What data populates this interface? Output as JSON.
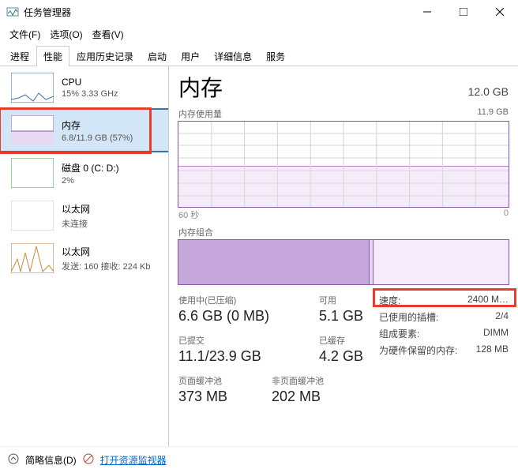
{
  "window": {
    "title": "任务管理器"
  },
  "menu": {
    "file": "文件(F)",
    "options": "选项(O)",
    "view": "查看(V)"
  },
  "tabs": [
    {
      "label": "进程"
    },
    {
      "label": "性能"
    },
    {
      "label": "应用历史记录"
    },
    {
      "label": "启动"
    },
    {
      "label": "用户"
    },
    {
      "label": "详细信息"
    },
    {
      "label": "服务"
    }
  ],
  "sidebar": [
    {
      "title": "CPU",
      "sub": "15% 3.33 GHz"
    },
    {
      "title": "内存",
      "sub": "6.8/11.9 GB (57%)"
    },
    {
      "title": "磁盘 0 (C: D:)",
      "sub": "2%"
    },
    {
      "title": "以太网",
      "sub": "未连接"
    },
    {
      "title": "以太网",
      "sub": "发送: 160 接收: 224 Kb"
    }
  ],
  "main": {
    "heading": "内存",
    "total": "12.0 GB",
    "usage_label": "内存使用量",
    "usage_right": "11.9 GB",
    "time_left": "60 秒",
    "time_right": "0",
    "compose_label": "内存组合"
  },
  "stats": {
    "r1c1_label": "使用中(已压缩)",
    "r1c1_val": "6.6 GB (0 MB)",
    "r1c2_label": "可用",
    "r1c2_val": "5.1 GB",
    "r2c1_label": "已提交",
    "r2c1_val": "11.1/23.9 GB",
    "r2c2_label": "已缓存",
    "r2c2_val": "4.2 GB",
    "r3c1_label": "页面缓冲池",
    "r3c1_val": "373 MB",
    "r3c2_label": "非页面缓冲池",
    "r3c2_val": "202 MB"
  },
  "details": {
    "speed_k": "速度:",
    "speed_v": "2400 M…",
    "slots_k": "已使用的插槽:",
    "slots_v": "2/4",
    "form_k": "组成要素:",
    "form_v": "DIMM",
    "reserved_k": "为硬件保留的内存:",
    "reserved_v": "128 MB"
  },
  "footer": {
    "fewer": "简略信息(D)",
    "resmon": "打开资源监视器"
  }
}
